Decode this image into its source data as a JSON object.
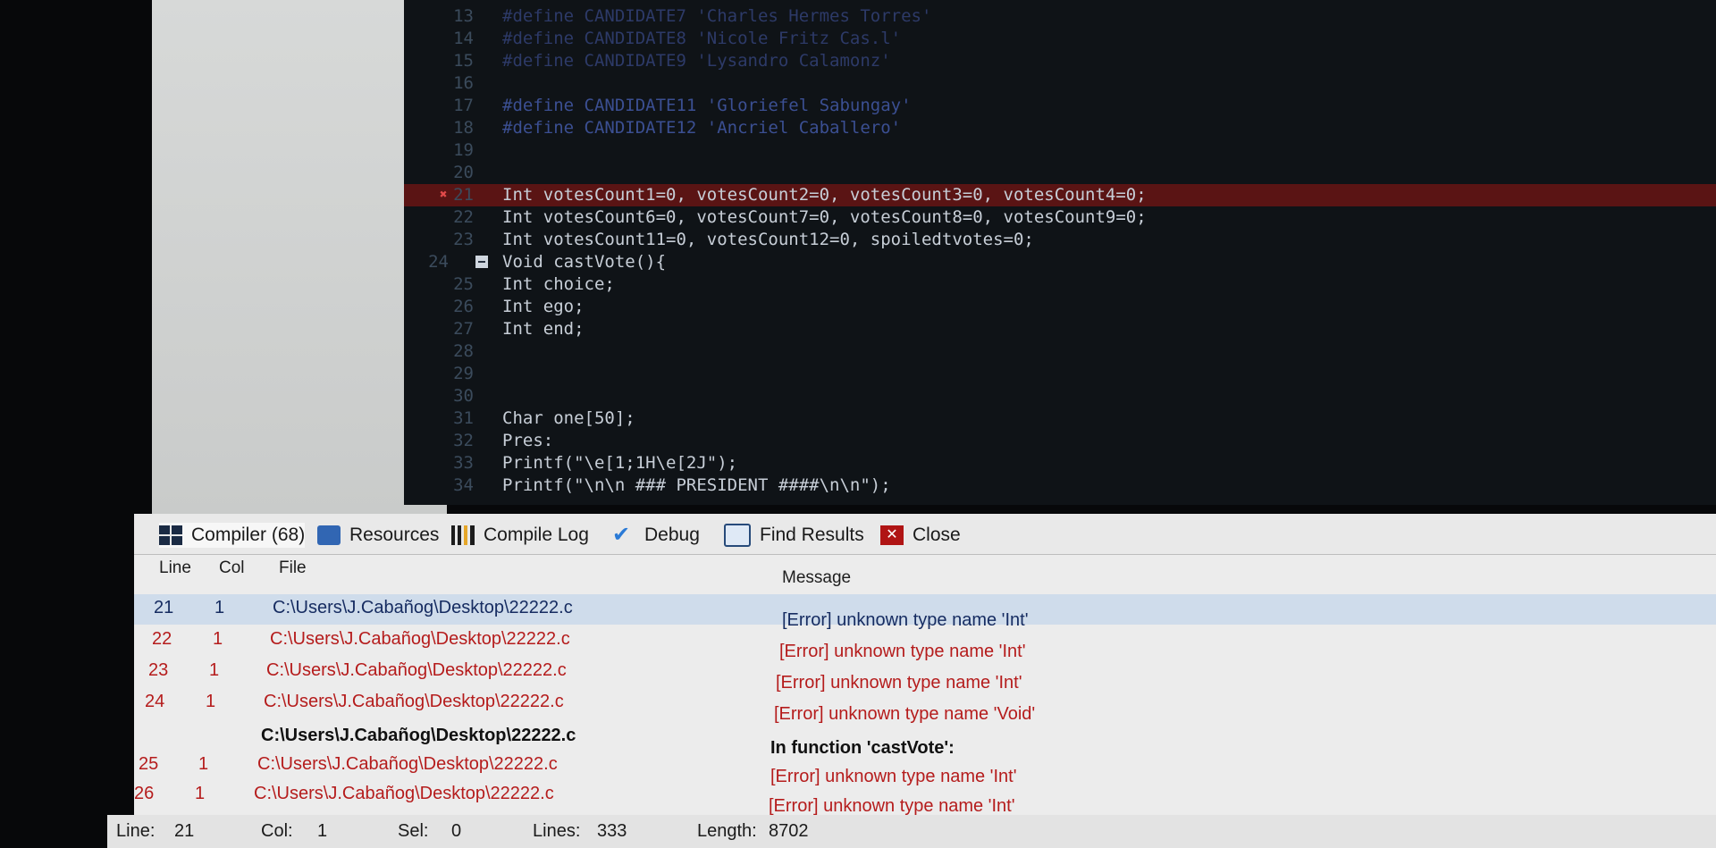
{
  "editor": {
    "lines": [
      {
        "num": "13",
        "text": "#define CANDIDATE7 'Charles Hermes Torres'"
      },
      {
        "num": "14",
        "text": "#define CANDIDATE8 'Nicole Fritz Cas.l'"
      },
      {
        "num": "15",
        "text": "#define CANDIDATE9 'Lysandro Calamonz'"
      },
      {
        "num": "16",
        "text": ""
      },
      {
        "num": "17",
        "text": "#define CANDIDATE11 'Gloriefel Sabungay'"
      },
      {
        "num": "18",
        "text": "#define CANDIDATE12 'Ancriel Caballero'"
      },
      {
        "num": "19",
        "text": ""
      },
      {
        "num": "20",
        "text": ""
      },
      {
        "num": "21",
        "text": "Int votesCount1=0, votesCount2=0, votesCount3=0, votesCount4=0;"
      },
      {
        "num": "22",
        "text": "Int votesCount6=0, votesCount7=0, votesCount8=0, votesCount9=0;"
      },
      {
        "num": "23",
        "text": "Int votesCount11=0, votesCount12=0, spoiledtvotes=0;"
      },
      {
        "num": "24",
        "text": "Void castVote(){"
      },
      {
        "num": "25",
        "text": "Int choice;"
      },
      {
        "num": "26",
        "text": "Int ego;"
      },
      {
        "num": "27",
        "text": "Int end;"
      },
      {
        "num": "28",
        "text": ""
      },
      {
        "num": "29",
        "text": ""
      },
      {
        "num": "30",
        "text": ""
      },
      {
        "num": "31",
        "text": "Char one[50];"
      },
      {
        "num": "32",
        "text": "Pres:"
      },
      {
        "num": "33",
        "text": "Printf(\"\\e[1;1H\\e[2J\");"
      },
      {
        "num": "34",
        "text": "Printf(\"\\n\\n ### PRESIDENT ####\\n\\n\");"
      }
    ]
  },
  "tabs": [
    {
      "label": "Compiler (68)",
      "icon": "grid-icon"
    },
    {
      "label": "Resources",
      "icon": "resources-icon"
    },
    {
      "label": "Compile Log",
      "icon": "chart-icon"
    },
    {
      "label": "Debug",
      "icon": "checkmark-icon"
    },
    {
      "label": "Find Results",
      "icon": "find-icon"
    },
    {
      "label": "Close",
      "icon": "close-icon"
    }
  ],
  "columns": {
    "line": "Line",
    "col": "Col",
    "file": "File",
    "message": "Message"
  },
  "rows": [
    {
      "line": "21",
      "col": "1",
      "file": "C:\\Users\\J.Cabañog\\Desktop\\22222.c",
      "message": "[Error] unknown type name 'Int'"
    },
    {
      "line": "22",
      "col": "1",
      "file": "C:\\Users\\J.Cabañog\\Desktop\\22222.c",
      "message": "[Error] unknown type name 'Int'"
    },
    {
      "line": "23",
      "col": "1",
      "file": "C:\\Users\\J.Cabañog\\Desktop\\22222.c",
      "message": "[Error] unknown type name 'Int'"
    },
    {
      "line": "24",
      "col": "1",
      "file": "C:\\Users\\J.Cabañog\\Desktop\\22222.c",
      "message": "[Error] unknown type name 'Void'"
    },
    {
      "line": "",
      "col": "",
      "file": "C:\\Users\\J.Cabañog\\Desktop\\22222.c",
      "message": "In function 'castVote':"
    },
    {
      "line": "25",
      "col": "1",
      "file": "C:\\Users\\J.Cabañog\\Desktop\\22222.c",
      "message": "[Error] unknown type name 'Int'"
    },
    {
      "line": "26",
      "col": "1",
      "file": "C:\\Users\\J.Cabañog\\Desktop\\22222.c",
      "message": "[Error] unknown type name 'Int'"
    }
  ],
  "status": {
    "line_label": "Line:",
    "line_value": "21",
    "col_label": "Col:",
    "col_value": "1",
    "sel_label": "Sel:",
    "sel_value": "0",
    "lines_label": "Lines:",
    "lines_value": "333",
    "length_label": "Length:",
    "length_value": "8702"
  }
}
